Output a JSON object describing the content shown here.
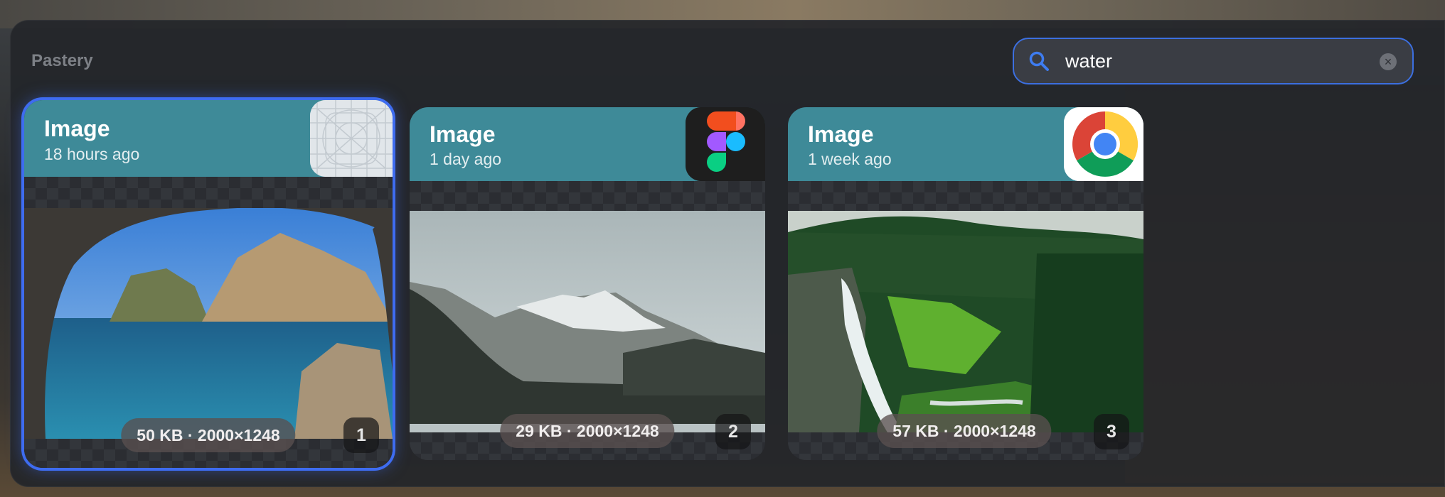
{
  "app": {
    "title": "Pastery"
  },
  "search": {
    "value": "water",
    "icon": "search-icon",
    "clear_icon": "clear-icon"
  },
  "colors": {
    "accent": "#3e6cf0",
    "header": "#3e8a98"
  },
  "cards": [
    {
      "type": "Image",
      "time": "18 hours ago",
      "app_icon": "app-grid-icon",
      "meta": "50 KB · 2000×1248",
      "index": "1",
      "selected": true
    },
    {
      "type": "Image",
      "time": "1 day ago",
      "app_icon": "figma-icon",
      "meta": "29 KB · 2000×1248",
      "index": "2",
      "selected": false
    },
    {
      "type": "Image",
      "time": "1 week ago",
      "app_icon": "chrome-icon",
      "meta": "57 KB · 2000×1248",
      "index": "3",
      "selected": false
    }
  ]
}
